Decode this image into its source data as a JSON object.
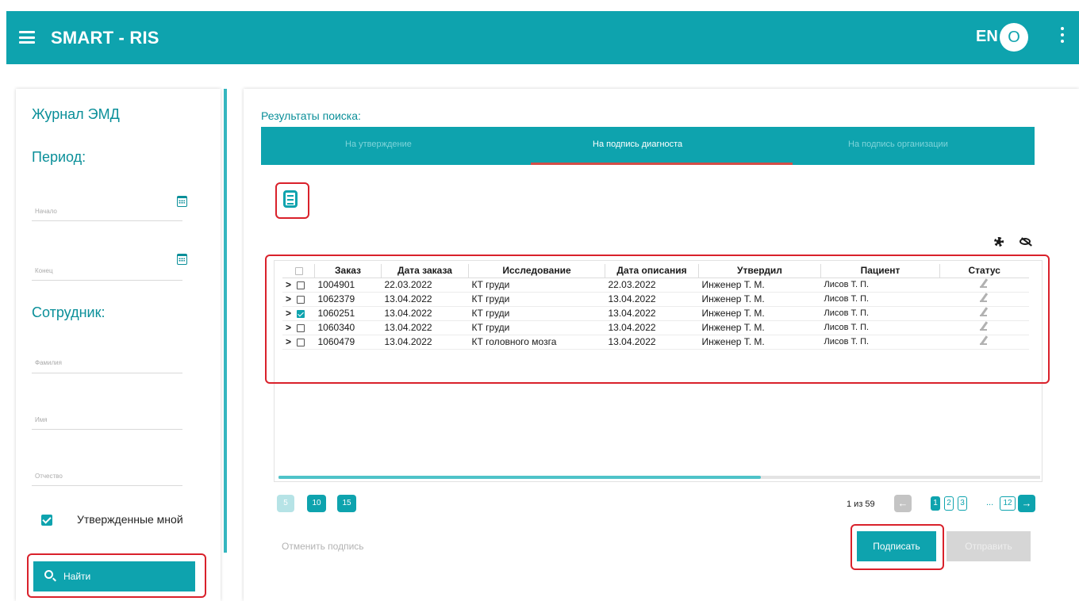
{
  "header": {
    "title": "SMART - RIS",
    "lang": "EN",
    "avatar_initial": "O"
  },
  "sidebar": {
    "title": "Журнал ЭМД",
    "period_heading": "Период:",
    "start_label": "Начало",
    "end_label": "Конец",
    "employee_heading": "Сотрудник:",
    "surname_label": "Фамилия",
    "name_label": "Имя",
    "patronymic_label": "Отчество",
    "approved_by_me_label": "Утвержденные мной",
    "approved_by_me_checked": true,
    "find_label": "Найти"
  },
  "main": {
    "results_title": "Результаты поиска:",
    "tabs": [
      {
        "label": "На утверждение",
        "active": false
      },
      {
        "label": "На подпись диагноста",
        "active": true
      },
      {
        "label": "На подпись организации",
        "active": false
      }
    ],
    "table": {
      "columns": [
        "Заказ",
        "Дата заказа",
        "Исследование",
        "Дата описания",
        "Утвердил",
        "Пациент",
        "Статус"
      ],
      "rows": [
        {
          "order": "1004901",
          "order_date": "22.03.2022",
          "study": "КТ груди",
          "desc_date": "22.03.2022",
          "approved_by": "Инженер Т. М.",
          "patient": "Лисов Т. П.",
          "checked": false
        },
        {
          "order": "1062379",
          "order_date": "13.04.2022",
          "study": "КТ груди",
          "desc_date": "13.04.2022",
          "approved_by": "Инженер Т. М.",
          "patient": "Лисов Т. П.",
          "checked": false
        },
        {
          "order": "1060251",
          "order_date": "13.04.2022",
          "study": "КТ груди",
          "desc_date": "13.04.2022",
          "approved_by": "Инженер Т. М.",
          "patient": "Лисов Т. П.",
          "checked": true
        },
        {
          "order": "1060340",
          "order_date": "13.04.2022",
          "study": "КТ груди",
          "desc_date": "13.04.2022",
          "approved_by": "Инженер Т. М.",
          "patient": "Лисов Т. П.",
          "checked": false
        },
        {
          "order": "1060479",
          "order_date": "13.04.2022",
          "study": "КТ головного мозга",
          "desc_date": "13.04.2022",
          "approved_by": "Инженер Т. М.",
          "patient": "Лисов Т. П.",
          "checked": false
        }
      ]
    },
    "page_sizes": [
      "5",
      "10",
      "15"
    ],
    "page_info": "1 из 59",
    "pages": [
      "1",
      "2",
      "3",
      "12"
    ],
    "ellipsis": "...",
    "cancel_sign_label": "Отменить подпись",
    "sign_label": "Подписать",
    "send_label": "Отправить"
  },
  "colors": {
    "primary": "#0ea3ae",
    "highlight": "#d9212b",
    "tab_indicator": "#d34d47"
  }
}
